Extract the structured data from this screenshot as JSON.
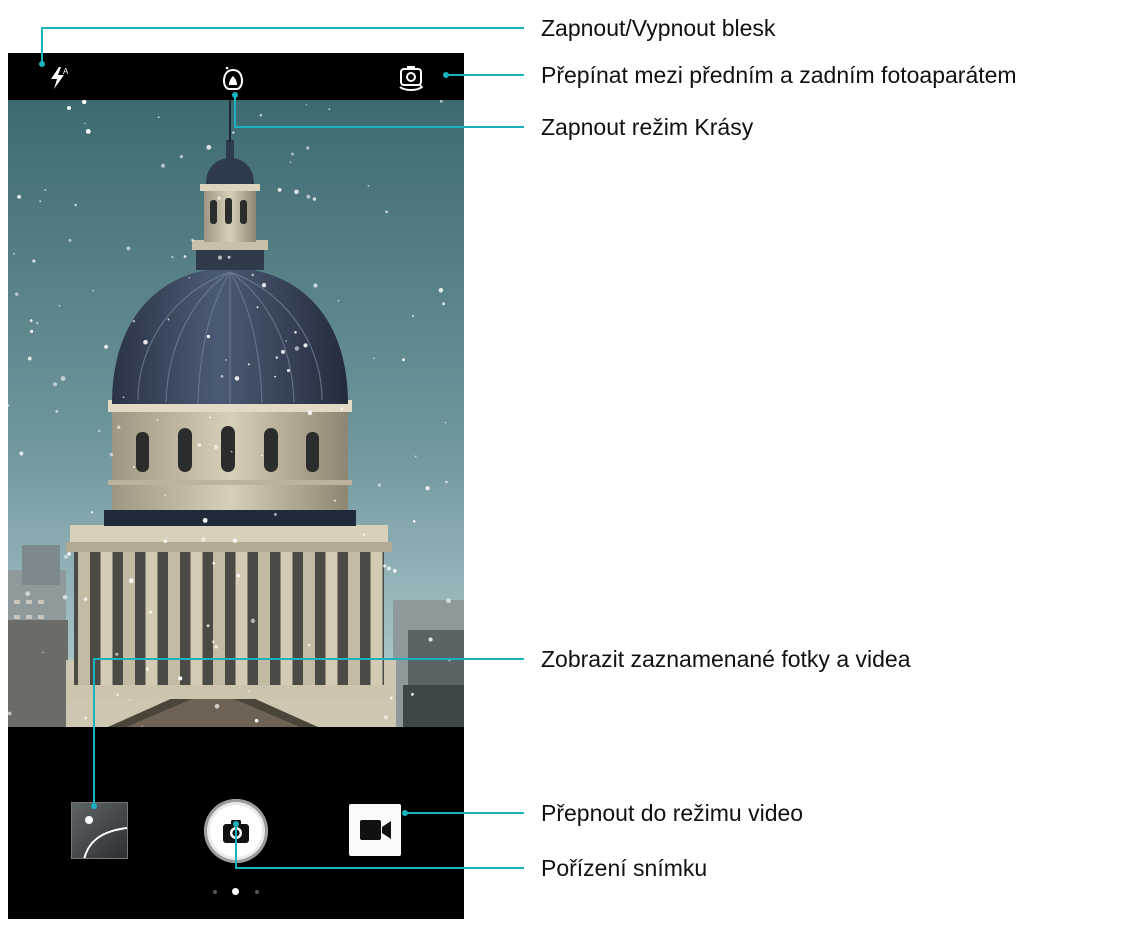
{
  "camera": {
    "topbar": {
      "flash_icon": "flash-auto-icon",
      "flash_badge": "A",
      "beauty_icon": "beauty-mode-icon",
      "switch_camera_icon": "switch-camera-icon"
    },
    "bottombar": {
      "gallery_icon": "gallery-thumbnail-icon",
      "shutter_icon": "camera-shutter-icon",
      "video_icon": "video-camera-icon",
      "pages": 3,
      "active_page": 2
    }
  },
  "callouts": {
    "flash": "Zapnout/Vypnout blesk",
    "switch_camera": "Přepínat mezi předním a zadním fotoaparátem",
    "beauty": "Zapnout režim Krásy",
    "gallery": "Zobrazit zaznamenané fotky a videa",
    "video": "Přepnout do režimu video",
    "shutter": "Pořízení snímku"
  },
  "colors": {
    "callout_line": "#19b2bd",
    "phone_background": "#000000",
    "sky_top": "#3d6a71",
    "sky_bottom": "#b9d2d5",
    "dome": "#2f3b52"
  }
}
